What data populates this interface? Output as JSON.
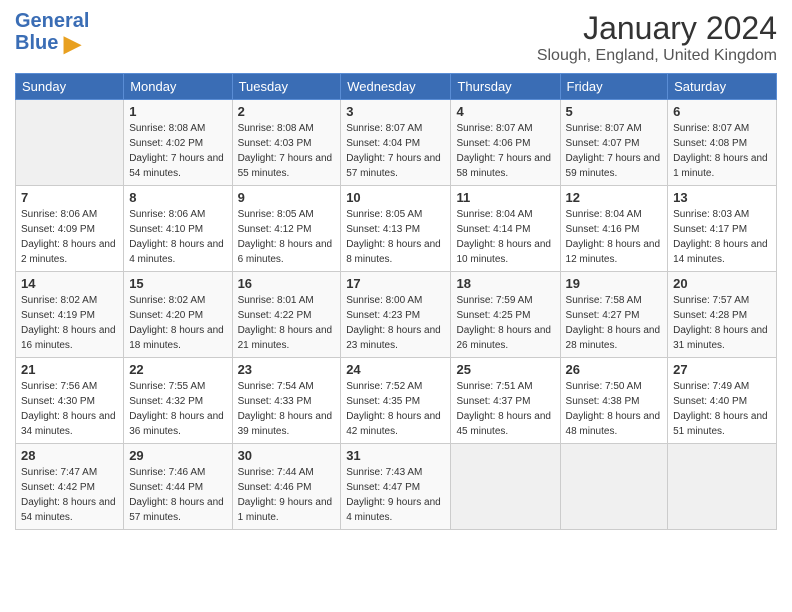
{
  "header": {
    "logo_text1": "General",
    "logo_text2": "Blue",
    "title": "January 2024",
    "location": "Slough, England, United Kingdom"
  },
  "days_of_week": [
    "Sunday",
    "Monday",
    "Tuesday",
    "Wednesday",
    "Thursday",
    "Friday",
    "Saturday"
  ],
  "weeks": [
    [
      {
        "day": "",
        "empty": true
      },
      {
        "day": "1",
        "sunrise": "8:08 AM",
        "sunset": "4:02 PM",
        "daylight": "7 hours and 54 minutes."
      },
      {
        "day": "2",
        "sunrise": "8:08 AM",
        "sunset": "4:03 PM",
        "daylight": "7 hours and 55 minutes."
      },
      {
        "day": "3",
        "sunrise": "8:07 AM",
        "sunset": "4:04 PM",
        "daylight": "7 hours and 57 minutes."
      },
      {
        "day": "4",
        "sunrise": "8:07 AM",
        "sunset": "4:06 PM",
        "daylight": "7 hours and 58 minutes."
      },
      {
        "day": "5",
        "sunrise": "8:07 AM",
        "sunset": "4:07 PM",
        "daylight": "7 hours and 59 minutes."
      },
      {
        "day": "6",
        "sunrise": "8:07 AM",
        "sunset": "4:08 PM",
        "daylight": "8 hours and 1 minute."
      }
    ],
    [
      {
        "day": "7",
        "sunrise": "8:06 AM",
        "sunset": "4:09 PM",
        "daylight": "8 hours and 2 minutes."
      },
      {
        "day": "8",
        "sunrise": "8:06 AM",
        "sunset": "4:10 PM",
        "daylight": "8 hours and 4 minutes."
      },
      {
        "day": "9",
        "sunrise": "8:05 AM",
        "sunset": "4:12 PM",
        "daylight": "8 hours and 6 minutes."
      },
      {
        "day": "10",
        "sunrise": "8:05 AM",
        "sunset": "4:13 PM",
        "daylight": "8 hours and 8 minutes."
      },
      {
        "day": "11",
        "sunrise": "8:04 AM",
        "sunset": "4:14 PM",
        "daylight": "8 hours and 10 minutes."
      },
      {
        "day": "12",
        "sunrise": "8:04 AM",
        "sunset": "4:16 PM",
        "daylight": "8 hours and 12 minutes."
      },
      {
        "day": "13",
        "sunrise": "8:03 AM",
        "sunset": "4:17 PM",
        "daylight": "8 hours and 14 minutes."
      }
    ],
    [
      {
        "day": "14",
        "sunrise": "8:02 AM",
        "sunset": "4:19 PM",
        "daylight": "8 hours and 16 minutes."
      },
      {
        "day": "15",
        "sunrise": "8:02 AM",
        "sunset": "4:20 PM",
        "daylight": "8 hours and 18 minutes."
      },
      {
        "day": "16",
        "sunrise": "8:01 AM",
        "sunset": "4:22 PM",
        "daylight": "8 hours and 21 minutes."
      },
      {
        "day": "17",
        "sunrise": "8:00 AM",
        "sunset": "4:23 PM",
        "daylight": "8 hours and 23 minutes."
      },
      {
        "day": "18",
        "sunrise": "7:59 AM",
        "sunset": "4:25 PM",
        "daylight": "8 hours and 26 minutes."
      },
      {
        "day": "19",
        "sunrise": "7:58 AM",
        "sunset": "4:27 PM",
        "daylight": "8 hours and 28 minutes."
      },
      {
        "day": "20",
        "sunrise": "7:57 AM",
        "sunset": "4:28 PM",
        "daylight": "8 hours and 31 minutes."
      }
    ],
    [
      {
        "day": "21",
        "sunrise": "7:56 AM",
        "sunset": "4:30 PM",
        "daylight": "8 hours and 34 minutes."
      },
      {
        "day": "22",
        "sunrise": "7:55 AM",
        "sunset": "4:32 PM",
        "daylight": "8 hours and 36 minutes."
      },
      {
        "day": "23",
        "sunrise": "7:54 AM",
        "sunset": "4:33 PM",
        "daylight": "8 hours and 39 minutes."
      },
      {
        "day": "24",
        "sunrise": "7:52 AM",
        "sunset": "4:35 PM",
        "daylight": "8 hours and 42 minutes."
      },
      {
        "day": "25",
        "sunrise": "7:51 AM",
        "sunset": "4:37 PM",
        "daylight": "8 hours and 45 minutes."
      },
      {
        "day": "26",
        "sunrise": "7:50 AM",
        "sunset": "4:38 PM",
        "daylight": "8 hours and 48 minutes."
      },
      {
        "day": "27",
        "sunrise": "7:49 AM",
        "sunset": "4:40 PM",
        "daylight": "8 hours and 51 minutes."
      }
    ],
    [
      {
        "day": "28",
        "sunrise": "7:47 AM",
        "sunset": "4:42 PM",
        "daylight": "8 hours and 54 minutes."
      },
      {
        "day": "29",
        "sunrise": "7:46 AM",
        "sunset": "4:44 PM",
        "daylight": "8 hours and 57 minutes."
      },
      {
        "day": "30",
        "sunrise": "7:44 AM",
        "sunset": "4:46 PM",
        "daylight": "9 hours and 1 minute."
      },
      {
        "day": "31",
        "sunrise": "7:43 AM",
        "sunset": "4:47 PM",
        "daylight": "9 hours and 4 minutes."
      },
      {
        "day": "",
        "empty": true
      },
      {
        "day": "",
        "empty": true
      },
      {
        "day": "",
        "empty": true
      }
    ]
  ],
  "labels": {
    "sunrise": "Sunrise:",
    "sunset": "Sunset:",
    "daylight": "Daylight:"
  }
}
